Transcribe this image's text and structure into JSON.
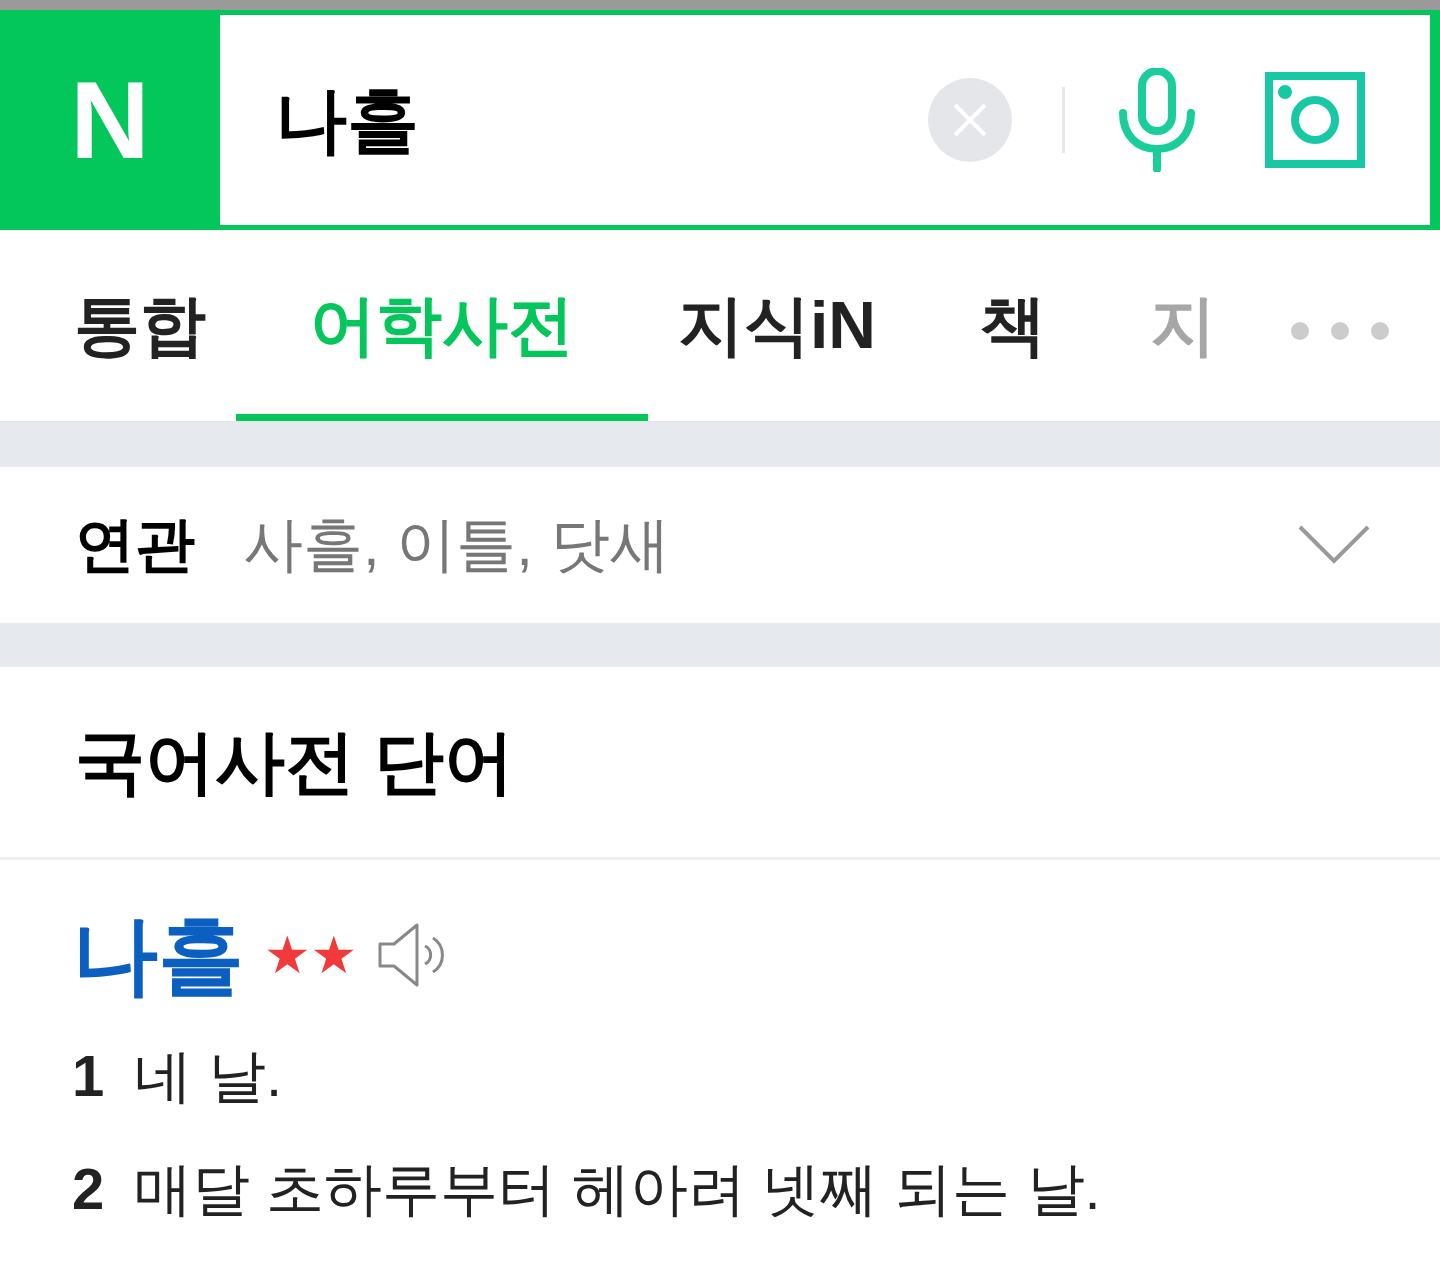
{
  "search": {
    "logo": "N",
    "value": "나흘"
  },
  "tabs": [
    {
      "label": "통합",
      "selected": false,
      "faded": false
    },
    {
      "label": "어학사전",
      "selected": true,
      "faded": false
    },
    {
      "label": "지식iN",
      "selected": false,
      "faded": false
    },
    {
      "label": "책",
      "selected": false,
      "faded": false
    },
    {
      "label": "지",
      "selected": false,
      "faded": true
    }
  ],
  "related": {
    "label": "연관",
    "terms": "사흘, 이틀, 닷새"
  },
  "section": {
    "title": "국어사전 단어"
  },
  "entry": {
    "word": "나흘",
    "importance": "★★",
    "definitions": [
      {
        "number": "1",
        "text": "네 날."
      },
      {
        "number": "2",
        "text": "매달 초하루부터 헤아려 넷째 되는 날."
      }
    ]
  }
}
